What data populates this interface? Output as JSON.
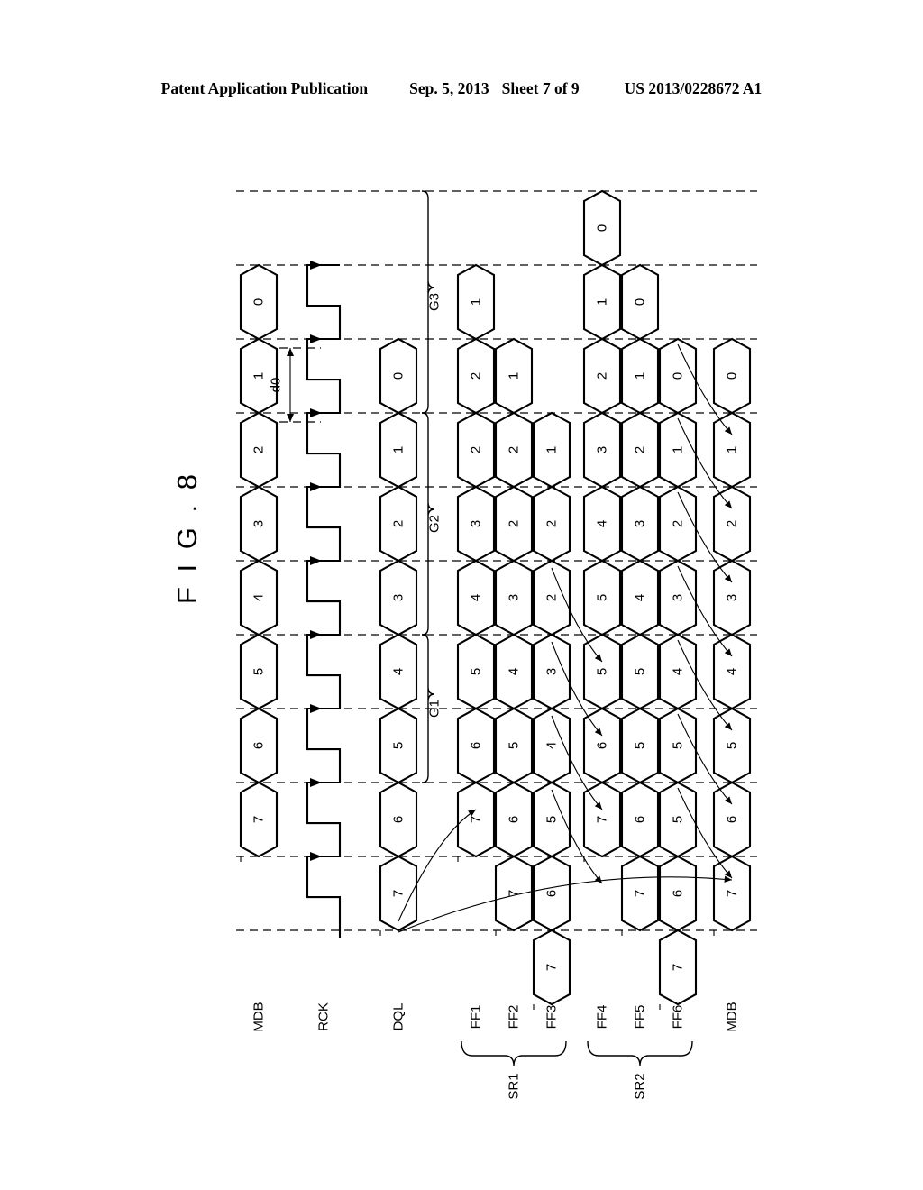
{
  "header": {
    "publication": "Patent Application Publication",
    "date": "Sep. 5, 2013",
    "sheet": "Sheet 7 of 9",
    "patent_number": "US 2013/0228672 A1"
  },
  "figure": {
    "title": "F I G .  8",
    "annotations": {
      "d0": "d0",
      "group1": "G1",
      "group2": "G2",
      "group3": "G3",
      "shift_register_1": "SR1",
      "shift_register_2": "SR2"
    }
  },
  "chart_data": {
    "type": "timing-diagram",
    "title": "FIG. 8",
    "orientation": "rotated-90-time-flows-bottom-to-top",
    "time_slots": 10,
    "signals": [
      {
        "name": "MDB",
        "row": 0,
        "kind": "bus",
        "start_slot": 1,
        "values": [
          "0",
          "1",
          "2",
          "3",
          "4",
          "5",
          "6",
          "7"
        ]
      },
      {
        "name": "RCK",
        "row": 1,
        "kind": "clock",
        "cycles": 8,
        "edge": "rising"
      },
      {
        "name": "DQL",
        "row": 2,
        "kind": "bus",
        "start_slot": 0,
        "values": [
          "0",
          "1",
          "2",
          "3",
          "4",
          "5",
          "6",
          "7"
        ]
      },
      {
        "name": "FF1",
        "row": 3,
        "kind": "bus",
        "start_slot": 1,
        "values": [
          "1",
          "2",
          "2",
          "3",
          "4",
          "5",
          "6",
          "7"
        ]
      },
      {
        "name": "FF2",
        "row": 4,
        "kind": "bus",
        "start_slot": 0,
        "values": [
          "1",
          "2",
          "2",
          "3",
          "4",
          "5",
          "6",
          "7"
        ]
      },
      {
        "name": "FF3",
        "row": 5,
        "kind": "bus",
        "start_slot": -1,
        "values": [
          "1",
          "2",
          "2",
          "3",
          "4",
          "5",
          "6",
          "7"
        ]
      },
      {
        "name": "FF4",
        "row": 6,
        "kind": "bus",
        "start_slot": 1,
        "values": [
          "0",
          "1",
          "2",
          "3",
          "4",
          "5",
          "5",
          "6",
          "7"
        ]
      },
      {
        "name": "FF5",
        "row": 7,
        "kind": "bus",
        "start_slot": 0,
        "values": [
          "0",
          "1",
          "2",
          "3",
          "4",
          "5",
          "5",
          "6",
          "7"
        ]
      },
      {
        "name": "FF6",
        "row": 8,
        "kind": "bus",
        "start_slot": -1,
        "values": [
          "0",
          "1",
          "2",
          "3",
          "4",
          "5",
          "5",
          "6",
          "7"
        ]
      },
      {
        "name": "MDB",
        "row": 9,
        "kind": "bus",
        "start_slot": 0,
        "values": [
          "0",
          "1",
          "2",
          "3",
          "4",
          "5",
          "6",
          "7"
        ]
      }
    ],
    "groups": [
      {
        "label": "G1",
        "signal": "DQL",
        "values": [
          "6",
          "7"
        ]
      },
      {
        "label": "G2",
        "signal": "DQL",
        "values": [
          "3",
          "4",
          "5"
        ]
      },
      {
        "label": "G3",
        "signal": "DQL",
        "values": [
          "0",
          "1",
          "2"
        ]
      }
    ],
    "register_brackets": [
      {
        "label": "SR1",
        "members": [
          "FF1",
          "FF2",
          "FF3"
        ]
      },
      {
        "label": "SR2",
        "members": [
          "FF4",
          "FF5",
          "FF6"
        ]
      }
    ],
    "interval_marker": {
      "label": "d0",
      "signal": "RCK",
      "span": "one clock period"
    }
  },
  "colors": {
    "ink": "#000000",
    "paper": "#ffffff"
  }
}
